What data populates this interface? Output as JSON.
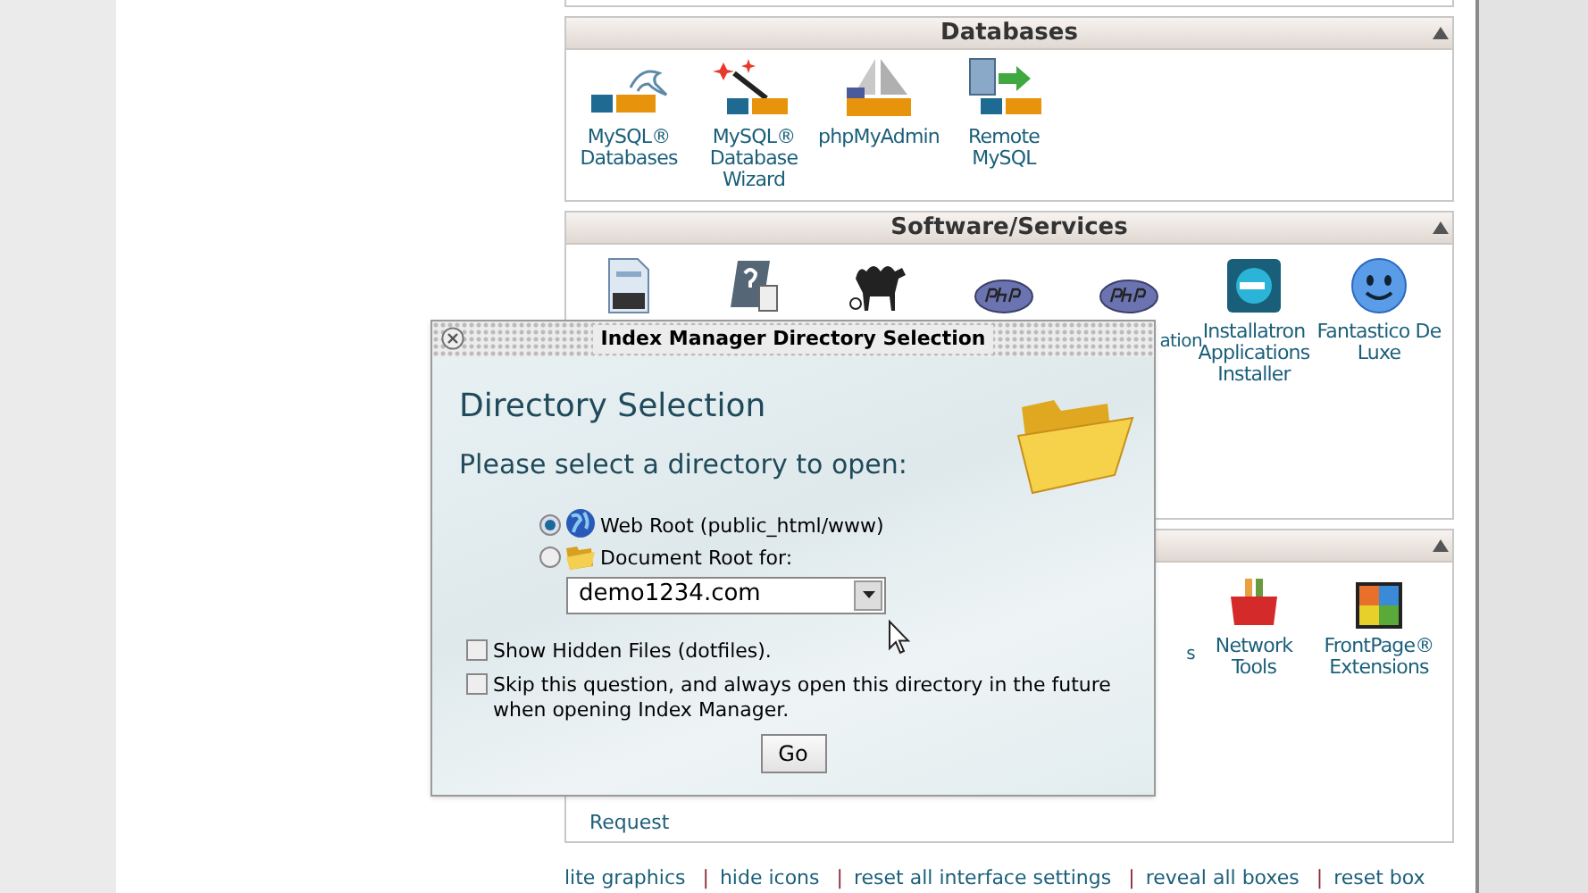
{
  "sections": [
    {
      "title": "Databases",
      "items": [
        {
          "kind": "mysql",
          "label": "MySQL® Databases"
        },
        {
          "kind": "mysql-wizard",
          "label": "MySQL® Database Wizard"
        },
        {
          "kind": "phpmyadmin",
          "label": "phpMyAdmin"
        },
        {
          "kind": "remote-mysql",
          "label": "Remote MySQL"
        }
      ]
    },
    {
      "title": "Software/Services",
      "items": [
        {
          "kind": "cgi"
        },
        {
          "kind": "help-doc"
        },
        {
          "kind": "perl"
        },
        {
          "kind": "php"
        },
        {
          "kind": "php",
          "partial_label": "ation"
        },
        {
          "kind": "installatron",
          "label": "Installatron Applications Installer"
        },
        {
          "kind": "fantastico",
          "label": "Fantastico De Luxe"
        }
      ]
    },
    {
      "items": [
        {
          "kind": "covered"
        },
        {
          "kind": "covered"
        },
        {
          "kind": "covered"
        },
        {
          "kind": "covered"
        },
        {
          "kind": "covered",
          "partial_label": "s"
        },
        {
          "kind": "network-tools",
          "label": "Network Tools"
        },
        {
          "kind": "frontpage",
          "label": "FrontPage® Extensions"
        }
      ],
      "trailing": "Request"
    }
  ],
  "links": {
    "separator": "|",
    "items": [
      "lite graphics",
      "hide icons",
      "reset all interface settings",
      "reveal all boxes",
      "reset box"
    ]
  },
  "dialog": {
    "title": "Index Manager Directory Selection",
    "heading": "Directory Selection",
    "prompt": "Please select a directory to open:",
    "radios": [
      {
        "kind": "globe",
        "label": "Web Root (public_html/www)",
        "selected": true
      },
      {
        "kind": "folder",
        "label": "Document Root for:",
        "selected": false
      }
    ],
    "domain": "demo1234.com",
    "checkboxes": [
      {
        "label": "Show Hidden Files (dotfiles).",
        "checked": false
      },
      {
        "label": "Skip this question, and always open this directory in the future when opening Index Manager.",
        "checked": false
      }
    ],
    "button": "Go"
  }
}
